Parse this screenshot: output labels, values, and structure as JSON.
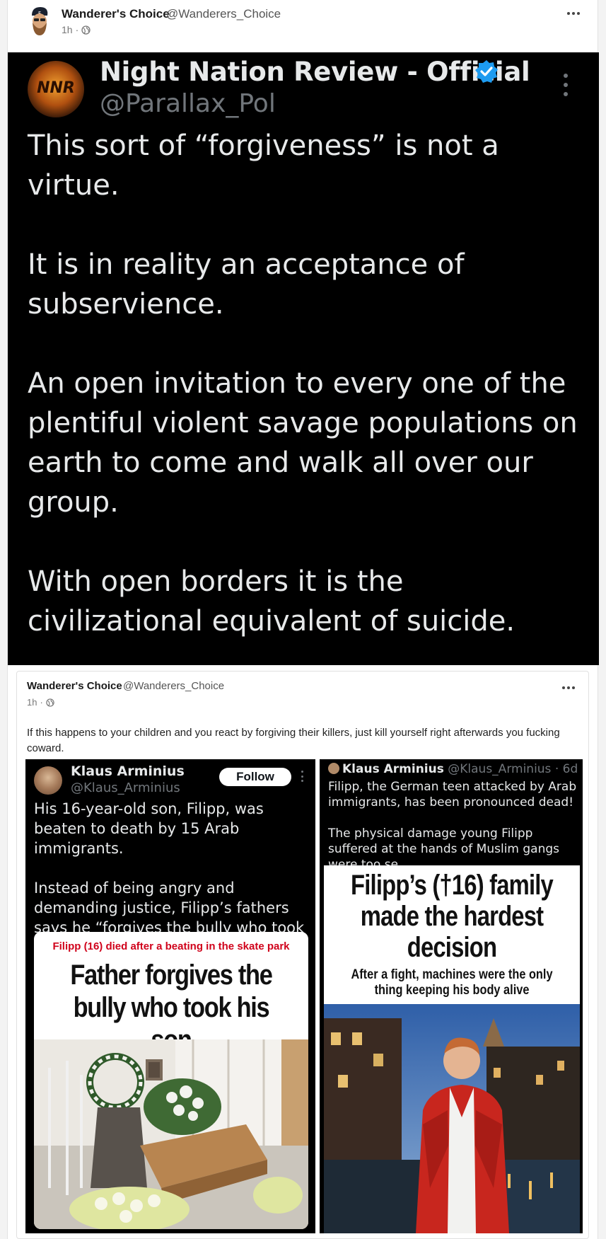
{
  "post": {
    "author_name": "Wanderer's Choice",
    "author_handle": "@Wanderers_Choice",
    "time": "1h",
    "time_sep": "·",
    "visibility_icon": "globe-icon",
    "more_icon": "more-options-icon"
  },
  "embedded_tweet": {
    "name": "Night Nation Review - Official",
    "handle": "@Parallax_Pol",
    "logo_text": "NNR",
    "verified_color": "#1d9bf0",
    "paragraphs": [
      "This sort of “forgiveness” is not a virtue.",
      "It is in reality an acceptance of subservience.",
      "An open invitation to every one of the plentiful violent savage populations on earth to come and walk all over our group.",
      "With open borders it is the civilizational equivalent of suicide."
    ]
  },
  "quoted_post": {
    "author_name": "Wanderer's Choice",
    "author_handle": "@Wanderers_Choice",
    "time": "1h",
    "time_sep": "·",
    "text": "If this happens to your children and you react by forgiving their killers, just kill yourself right afterwards you fucking coward."
  },
  "left_tweet": {
    "name": "Klaus Arminius",
    "handle": "@Klaus_Arminius",
    "follow_label": "Follow",
    "paragraphs": [
      "His 16-year-old son, Filipp, was beaten to death by 15 Arab immigrants.",
      "Instead of being angry and demanding justice, Filipp’s fathers says he “forgives the bully who took his son”"
    ],
    "article_kicker": "Filipp (16) died after a beating in the skate park",
    "article_headline": "Father forgives the bully who took his son"
  },
  "right_tweet": {
    "name": "Klaus Arminius",
    "handle_time": "@Klaus_Arminius · 6d",
    "paragraphs": [
      "Filipp, the German teen attacked by Arab immigrants, has been pronounced dead!",
      "The physical damage young Filipp suffered at the hands of Muslim gangs were too se..."
    ],
    "article_headline": "Filipp’s (†16) family made the hardest decision",
    "article_sub": "After a fight, machines were the only thing keeping his body alive"
  },
  "colors": {
    "tweet_bg": "#000000",
    "tweet_text": "#e7e9ea",
    "tweet_muted": "#71767b",
    "kicker_red": "#d0021b"
  }
}
